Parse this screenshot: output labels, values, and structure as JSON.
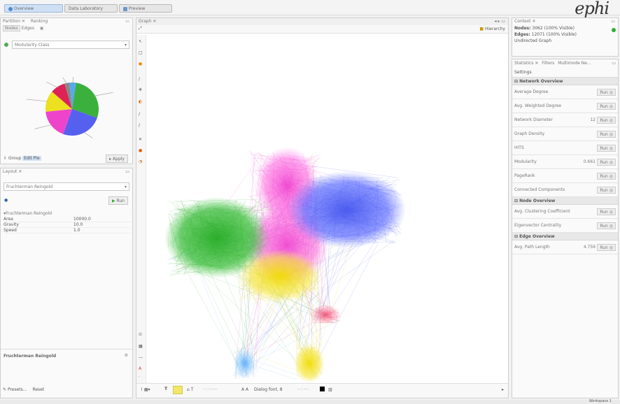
{
  "topbar": {
    "tabs": [
      "Overview",
      "Data Laboratory",
      "Preview"
    ],
    "logo": "ephi"
  },
  "left": {
    "partition_title": "Partition",
    "ranking_tab": "Ranking",
    "nodes_tab": "Nodes",
    "edges_tab": "Edges",
    "partition_param": "Modularity Class",
    "group_label": "Group",
    "edit_pie": "Edit Pie",
    "apply_label": "Apply",
    "pie_slices": [
      {
        "color": "#3cb03c",
        "pct": 28
      },
      {
        "color": "#5560ee",
        "pct": 25
      },
      {
        "color": "#ee44cc",
        "pct": 18
      },
      {
        "color": "#ede01e",
        "pct": 13
      },
      {
        "color": "#dd2255",
        "pct": 9
      },
      {
        "color": "#888888",
        "pct": 3
      },
      {
        "color": "#55aaee",
        "pct": 4
      }
    ],
    "layout_title": "Layout",
    "layout_algo": "Fruchterman Reingold",
    "run_label": "Run",
    "props_title": "Fruchterman Reingold",
    "props": [
      {
        "name": "Area",
        "value": "10000.0"
      },
      {
        "name": "Gravity",
        "value": "10.0"
      },
      {
        "name": "Speed",
        "value": "1.0"
      }
    ],
    "desc_title": "Fruchterman Reingold",
    "presets": "Presets...",
    "reset": "Reset"
  },
  "graph": {
    "title": "Graph",
    "mode_label": "Hierarchy",
    "bottom_label": "Dialog font",
    "bottom_value": "8"
  },
  "right": {
    "context_title": "Context",
    "nodes_label": "Nodes:",
    "nodes_value": "3062 (100% Visible)",
    "edges_label": "Edges:",
    "edges_value": "12071 (100% Visible)",
    "graph_type": "Undirected Graph",
    "tabs": [
      "Statistics",
      "Filters",
      "Multimode Ne..."
    ],
    "settings": "Settings",
    "sections": [
      {
        "title": "Network Overview",
        "rows": [
          {
            "name": "Average Degree",
            "value": ""
          },
          {
            "name": "Avg. Weighted Degree",
            "value": ""
          },
          {
            "name": "Network Diameter",
            "value": "12"
          },
          {
            "name": "Graph Density",
            "value": ""
          },
          {
            "name": "HITS",
            "value": ""
          },
          {
            "name": "Modularity",
            "value": "0.661"
          },
          {
            "name": "PageRank",
            "value": ""
          },
          {
            "name": "Connected Components",
            "value": ""
          }
        ]
      },
      {
        "title": "Node Overview",
        "rows": [
          {
            "name": "Avg. Clustering Coefficient",
            "value": ""
          },
          {
            "name": "Eigenvector Centrality",
            "value": ""
          }
        ]
      },
      {
        "title": "Edge Overview",
        "rows": [
          {
            "name": "Avg. Path Length",
            "value": "4.759"
          }
        ]
      }
    ],
    "run": "Run"
  },
  "status": {
    "workspace": "Workspace 1"
  }
}
